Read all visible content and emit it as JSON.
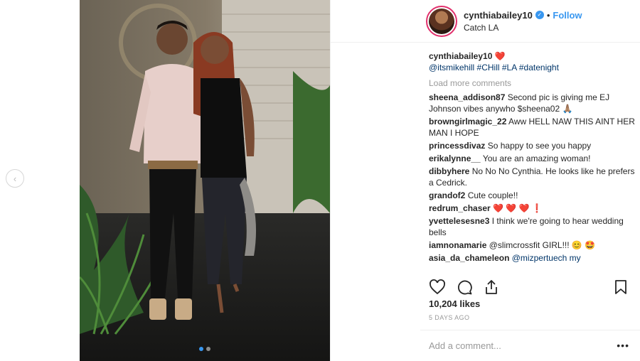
{
  "post": {
    "author": {
      "username": "cynthiabailey10",
      "verified_icon": "check-icon",
      "separator": "•",
      "follow_label": "Follow",
      "location": "Catch LA"
    },
    "caption": {
      "username": "cynthiabailey10",
      "emoji": "❤️",
      "tags": "@itsmikehill #CHill #LA #datenight"
    },
    "load_more_label": "Load more comments",
    "comments": [
      {
        "user": "sheena_addison87",
        "text": "Second pic is giving me EJ Johnson vibes anywho $sheena02 🙏🏽"
      },
      {
        "user": "browngirlmagic_22",
        "text": "Aww HELL NAW THIS AINT HER MAN I HOPE"
      },
      {
        "user": "princessdivaz",
        "text": "So happy to see you happy"
      },
      {
        "user": "erikalynne__",
        "text": "You are an amazing woman!"
      },
      {
        "user": "dibbyhere",
        "text": "No No No Cynthia. He looks like he prefers a Cedrick."
      },
      {
        "user": "grandof2",
        "text": "Cute couple!!"
      },
      {
        "user": "redrum_chaser",
        "text": "❤️ ❤️ ❤️ ❗"
      },
      {
        "user": "yvettelesesne3",
        "text": "I think we're going to hear wedding bells"
      },
      {
        "user": "iamnonamarie",
        "text": "@slimcrossfit GIRL!!! 😊 🤩"
      },
      {
        "user": "asia_da_chameleon",
        "text": "@mizpertuech my"
      }
    ],
    "likes": "10,204 likes",
    "time": "5 DAYS AGO",
    "add_comment_placeholder": "Add a comment...",
    "more_label": "•••"
  },
  "carousel": {
    "count": 2,
    "active": 1
  },
  "nav": {
    "prev_icon": "chevron-left-icon",
    "prev_label": "‹"
  },
  "icons": [
    "heart-icon",
    "comment-icon",
    "share-icon",
    "bookmark-icon"
  ],
  "colors": {
    "accent": "#3897f0",
    "heart": "#ed4956",
    "tag": "#003569",
    "muted": "#999999"
  }
}
